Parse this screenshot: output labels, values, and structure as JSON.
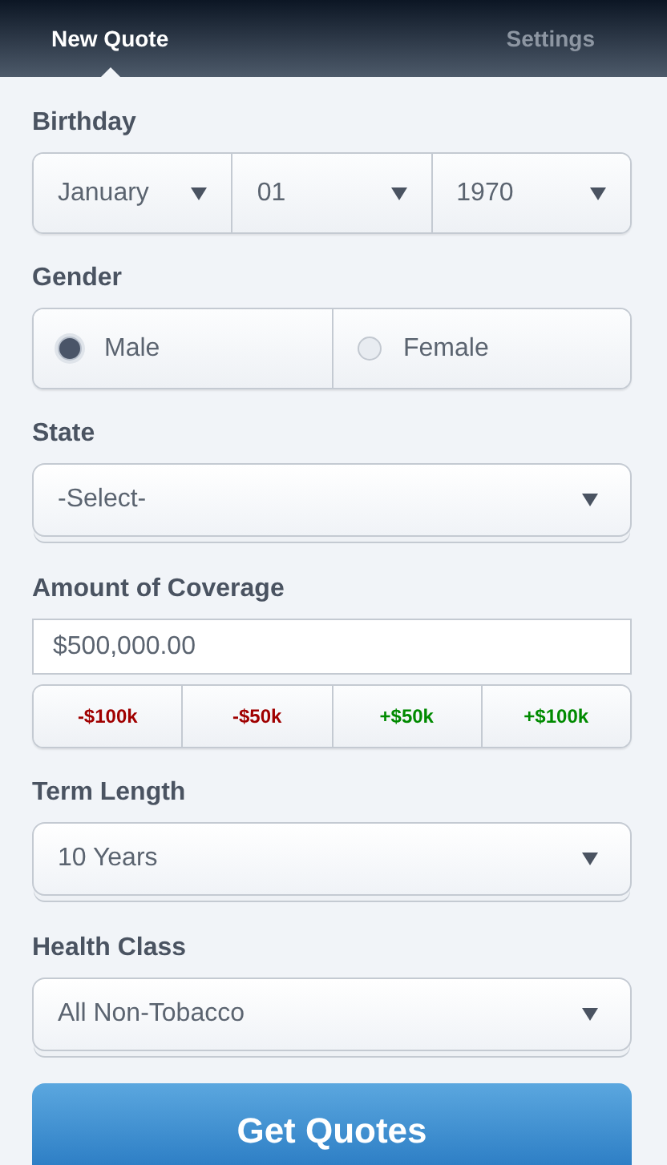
{
  "tabs": [
    {
      "label": "New Quote",
      "selected": true
    },
    {
      "label": "Settings",
      "selected": false
    }
  ],
  "birthday": {
    "label": "Birthday",
    "selects": [
      {
        "value": "January"
      },
      {
        "value": "01"
      },
      {
        "value": "1970"
      }
    ]
  },
  "gender": {
    "label": "Gender",
    "options": [
      {
        "label": "Male",
        "selected": true
      },
      {
        "label": "Female",
        "selected": false
      }
    ]
  },
  "state": {
    "label": "State",
    "value": "-Select-"
  },
  "coverage": {
    "label": "Amount of Coverage",
    "value": "$500,000.00",
    "adjustments": [
      {
        "label": "-$100k",
        "color": "#a00000"
      },
      {
        "label": "-$50k",
        "color": "#a00000"
      },
      {
        "label": "+$50k",
        "color": "#008a00"
      },
      {
        "label": "+$100k",
        "color": "#008a00"
      }
    ]
  },
  "term": {
    "label": "Term Length",
    "value": "10 Years"
  },
  "health": {
    "label": "Health Class",
    "value": "All Non-Tobacco"
  },
  "submit": {
    "label": "Get Quotes"
  }
}
